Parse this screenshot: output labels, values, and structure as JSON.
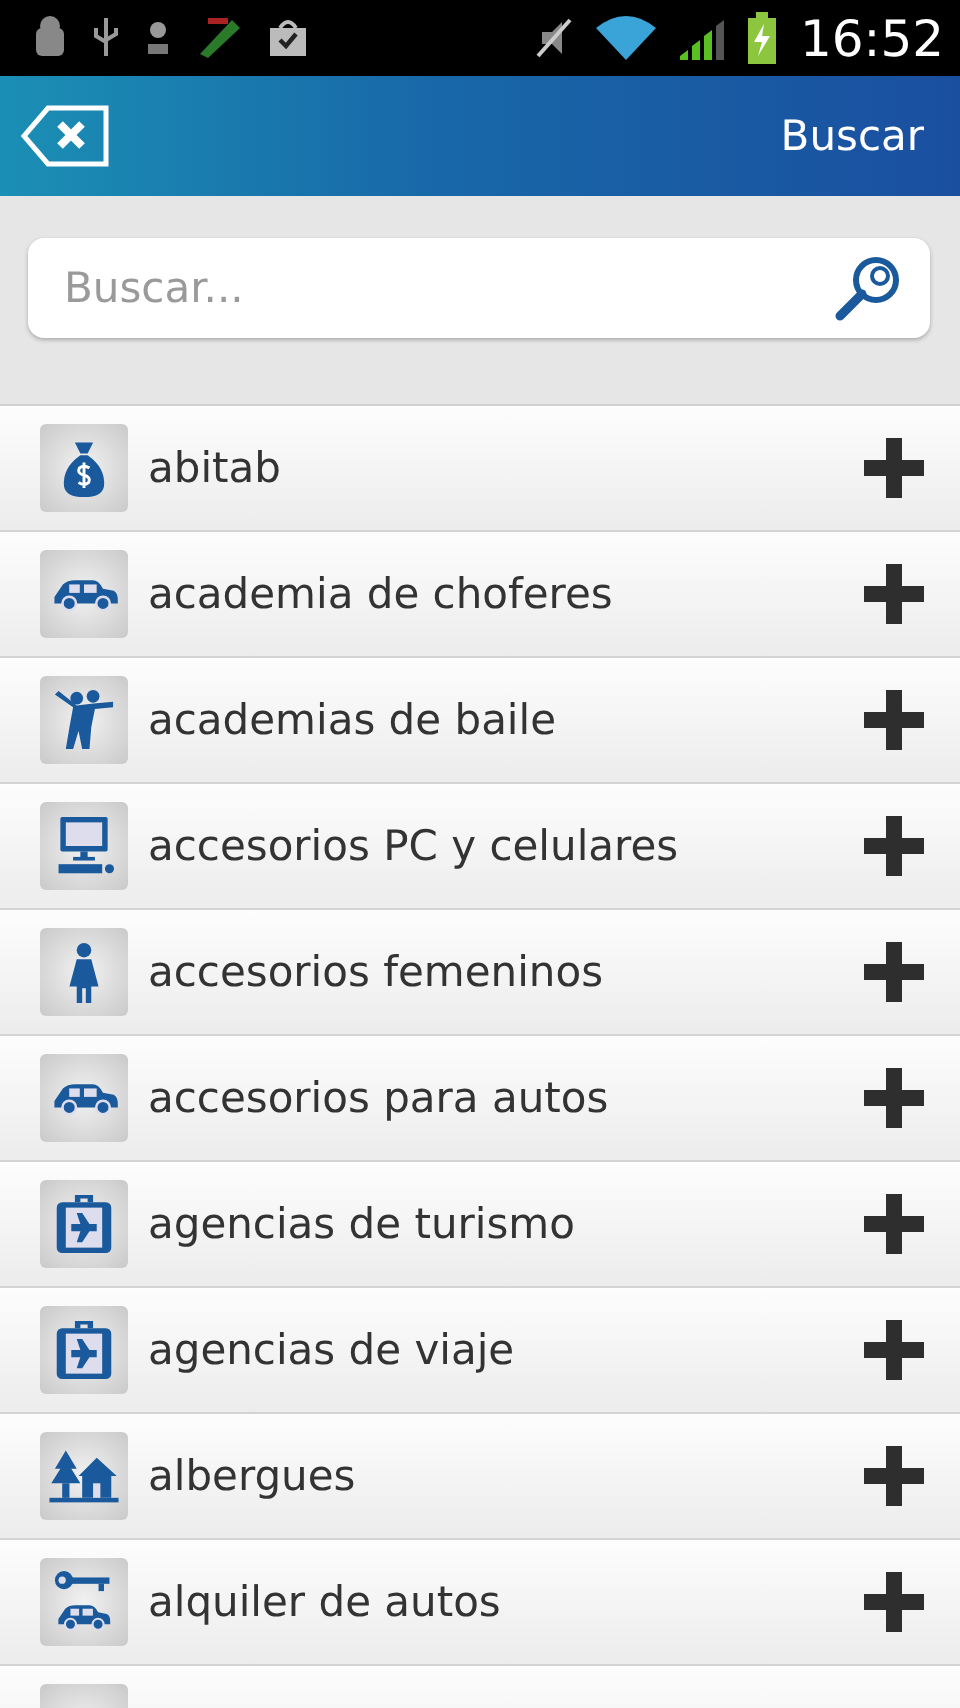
{
  "status_bar": {
    "time": "16:52"
  },
  "header": {
    "title": "Buscar"
  },
  "search": {
    "placeholder": "Buscar..."
  },
  "items": [
    {
      "label": "abitab",
      "kind": "money"
    },
    {
      "label": "academia de choferes",
      "kind": "car"
    },
    {
      "label": "academias de baile",
      "kind": "dance"
    },
    {
      "label": "accesorios PC y celulares",
      "kind": "computer"
    },
    {
      "label": "accesorios femeninos",
      "kind": "woman"
    },
    {
      "label": "accesorios para autos",
      "kind": "car"
    },
    {
      "label": "agencias de turismo",
      "kind": "suitcase"
    },
    {
      "label": "agencias de viaje",
      "kind": "suitcase"
    },
    {
      "label": "albergues",
      "kind": "house"
    },
    {
      "label": "alquiler de autos",
      "kind": "keycar"
    }
  ]
}
